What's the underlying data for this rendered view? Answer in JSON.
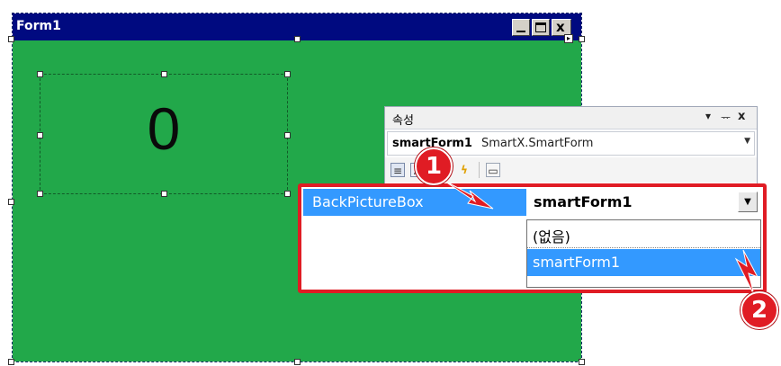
{
  "form": {
    "title": "Form1",
    "label_value": "0",
    "close_glyph": "x",
    "background_color": "#22a84a"
  },
  "properties_window": {
    "title": "속성",
    "pin_glyph": "▾",
    "dock_glyph": "ᅲ",
    "close_glyph": "x",
    "object_name": "smartForm1",
    "object_type": "SmartX.SmartForm",
    "toolbar": {
      "categorized_icon": "categorized-icon",
      "alphabetical_icon": "alphabetical-icon",
      "properties_icon": "properties-icon",
      "events_icon": "lightning-icon",
      "property_pages_icon": "property-pages-icon"
    }
  },
  "property_editor": {
    "name": "BackPictureBox",
    "value": "smartForm1",
    "options": [
      "(없음)",
      "smartForm1"
    ],
    "selected_index": 1
  },
  "callouts": {
    "step1": "1",
    "step2": "2"
  },
  "colors": {
    "highlight": "#e01c24",
    "selection": "#3399ff",
    "titlebar": "#000a80"
  }
}
